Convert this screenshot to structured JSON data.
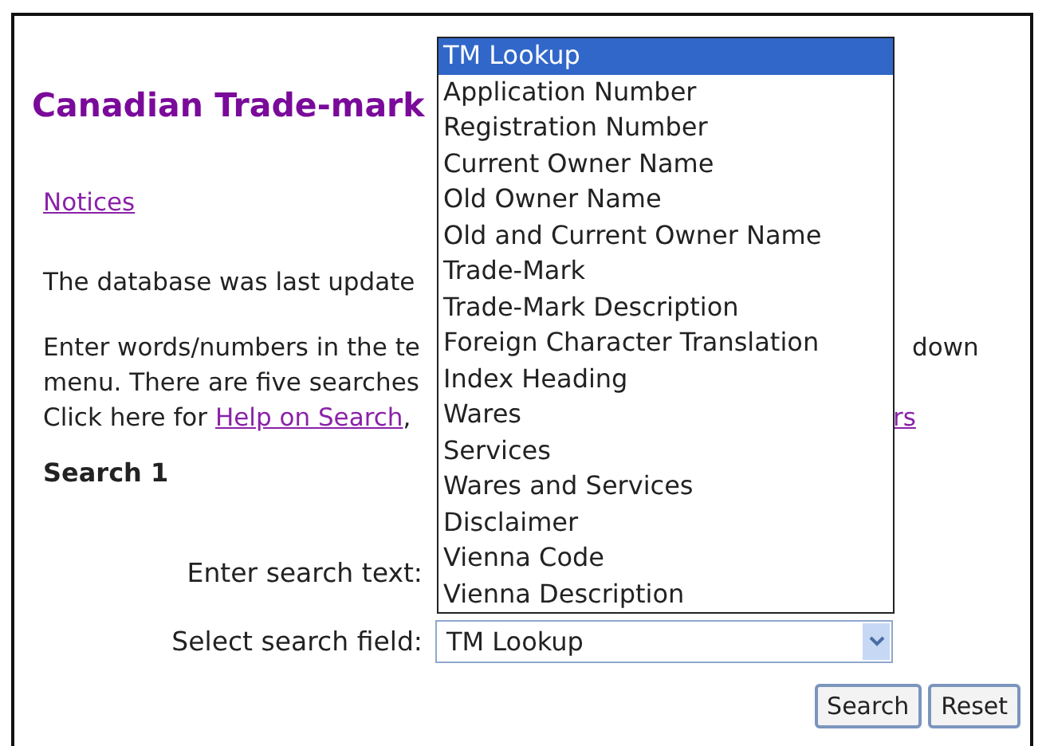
{
  "heading": "Canadian Trade-mark",
  "notices_link": "Notices",
  "update_text": "The database was last update",
  "instructions": [
    {
      "left": "Enter words/numbers in the te",
      "right": "down"
    },
    {
      "left": "menu. There are five searches"
    }
  ],
  "help_line": {
    "prefix": "Click here for",
    "link": "Help on Search",
    "suffix": ",",
    "right_link": "rs"
  },
  "section_title": "Search 1",
  "search_text_label": "Enter search text:",
  "select_field": {
    "label": "Select search field:",
    "value": "TM Lookup"
  },
  "dropdown": {
    "options": [
      {
        "label": "TM Lookup",
        "selected": true
      },
      {
        "label": "Application Number",
        "selected": false
      },
      {
        "label": "Registration Number",
        "selected": false
      },
      {
        "label": "Current Owner Name",
        "selected": false
      },
      {
        "label": "Old Owner Name",
        "selected": false
      },
      {
        "label": "Old and Current Owner Name",
        "selected": false
      },
      {
        "label": "Trade-Mark",
        "selected": false
      },
      {
        "label": "Trade-Mark Description",
        "selected": false
      },
      {
        "label": "Foreign Character Translation",
        "selected": false
      },
      {
        "label": "Index Heading",
        "selected": false
      },
      {
        "label": "Wares",
        "selected": false
      },
      {
        "label": "Services",
        "selected": false
      },
      {
        "label": "Wares and Services",
        "selected": false
      },
      {
        "label": "Disclaimer",
        "selected": false
      },
      {
        "label": "Vienna Code",
        "selected": false
      },
      {
        "label": "Vienna Description",
        "selected": false
      }
    ]
  },
  "buttons": [
    "Search",
    "Reset"
  ]
}
